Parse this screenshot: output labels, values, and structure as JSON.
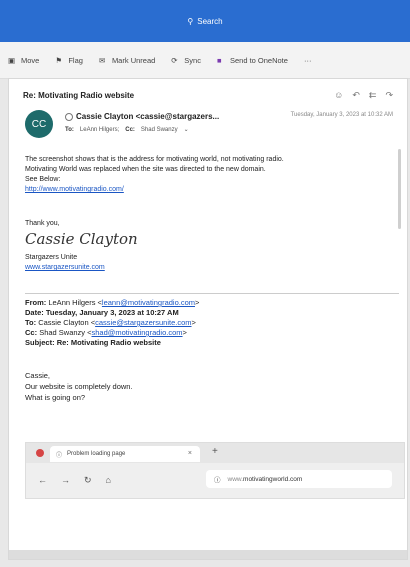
{
  "header": {
    "search_label": "Search"
  },
  "toolbar": {
    "move": "Move",
    "flag": "Flag",
    "mark_unread": "Mark Unread",
    "sync": "Sync",
    "send_to_onenote": "Send to OneNote",
    "more": "···"
  },
  "message": {
    "subject": "Re: Motivating Radio website",
    "avatar_initials": "CC",
    "sender": "Cassie Clayton <cassie@stargazers...",
    "to_label": "To:",
    "to": "LeAnn Hilgers;",
    "cc_label": "Cc:",
    "cc": "Shad Swanzy",
    "date": "Tuesday, January 3, 2023 at 10:32 AM",
    "body_line1": "The screenshot shows that is the address for motivating world, not motivating radio.",
    "body_line2": "Motivating World was replaced when the site was directed to the new domain.",
    "body_line3": "See Below:",
    "body_link": "http://www.motivatingradio.com/",
    "thanks": "Thank you,",
    "signature": "Cassie Clayton",
    "company": "Stargazers Unite",
    "company_link": "www.stargazersunite.com"
  },
  "quoted": {
    "from_label": "From:",
    "from_name": "LeAnn Hilgers <",
    "from_email": "leann@motivatingradio.com",
    "from_end": ">",
    "date_label": "Date:",
    "date": "Tuesday, January 3, 2023 at 10:27 AM",
    "to_label": "To:",
    "to_name": "Cassie Clayton <",
    "to_email": "cassie@stargazersunite.com",
    "to_end": ">",
    "cc_label": "Cc:",
    "cc_name": "Shad Swanzy <",
    "cc_email": "shad@motivatingradio.com",
    "cc_end": ">",
    "subject_label": "Subject:",
    "subject": "Re: Motivating Radio website",
    "greeting": "Cassie,",
    "line1": "Our website is completely down.",
    "line2": "What is going on?"
  },
  "browser": {
    "tab_title": "Problem loading page",
    "tab_close": "×",
    "new_tab": "+",
    "url_scheme": "www.",
    "url": "motivatingworld.com"
  }
}
